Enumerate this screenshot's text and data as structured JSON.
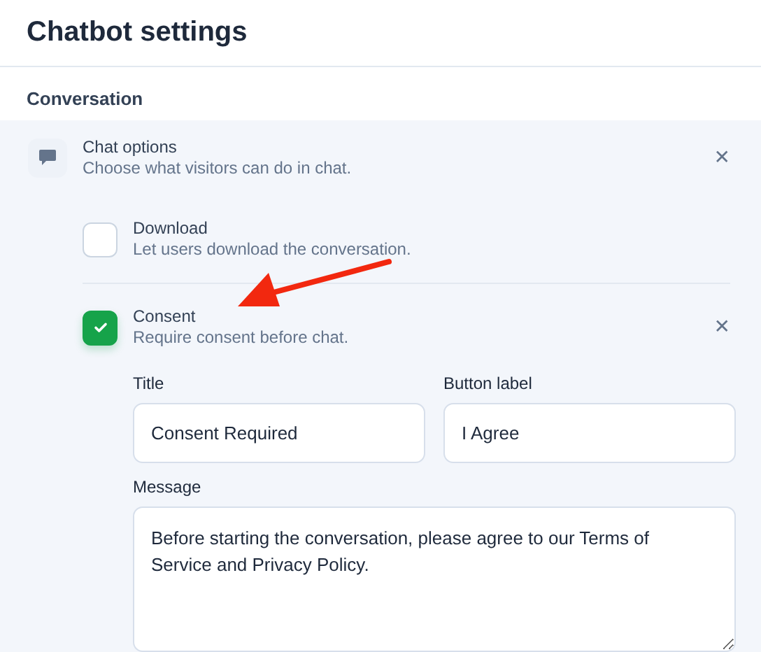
{
  "title": "Chatbot settings",
  "section": "Conversation",
  "group": {
    "title": "Chat options",
    "description": "Choose what visitors can do in chat.",
    "close": "✕"
  },
  "options": [
    {
      "label": "Download",
      "description": "Let users download the conversation.",
      "checked": false
    },
    {
      "label": "Consent",
      "description": "Require consent before chat.",
      "checked": true,
      "close": "✕",
      "fields": [
        {
          "kind": "input",
          "label": "Title",
          "value": "Consent Required"
        },
        {
          "kind": "input",
          "label": "Button label",
          "value": "I Agree"
        },
        {
          "kind": "textarea",
          "label": "Message",
          "value": "Before starting the conversation, please agree to our Terms of Service and Privacy Policy."
        }
      ]
    }
  ]
}
